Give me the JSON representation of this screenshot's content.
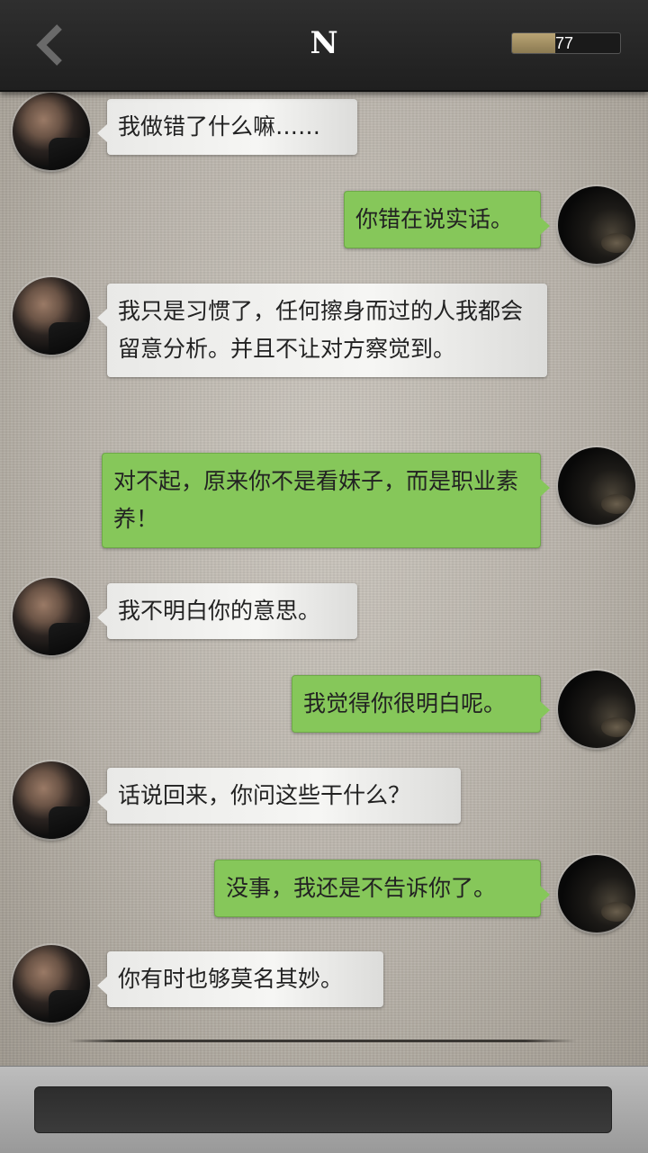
{
  "header": {
    "title": "N",
    "battery": {
      "value": "77",
      "level": 0.4
    }
  },
  "messages": [
    {
      "side": "left",
      "text": "我做错了什么嘛……"
    },
    {
      "side": "right",
      "text": "你错在说实话。"
    },
    {
      "side": "left",
      "text": "我只是习惯了，任何擦身而过的人我都会留意分析。并且不让对方察觉到。"
    },
    {
      "side": "right",
      "text": "对不起，原来你不是看妹子，而是职业素养！"
    },
    {
      "side": "left",
      "text": "我不明白你的意思。"
    },
    {
      "side": "right",
      "text": "我觉得你很明白呢。"
    },
    {
      "side": "left",
      "text": "话说回来，你问这些干什么？"
    },
    {
      "side": "right",
      "text": "没事，我还是不告诉你了。"
    },
    {
      "side": "left",
      "text": "你有时也够莫名其妙。"
    }
  ],
  "composer": {
    "value": ""
  }
}
